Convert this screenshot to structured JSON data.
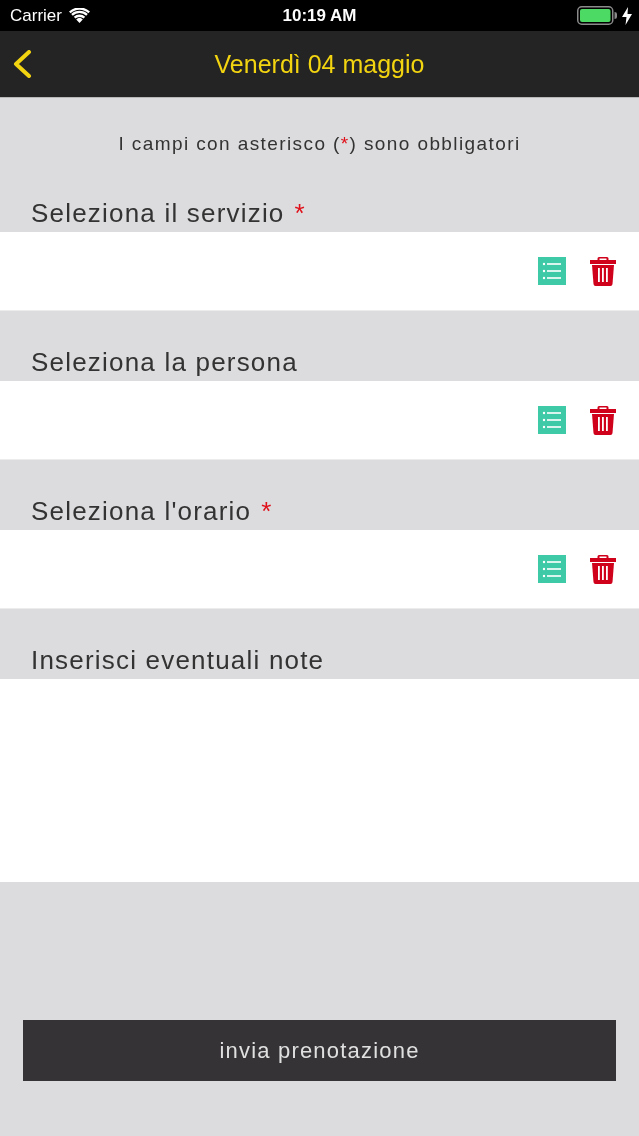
{
  "status_bar": {
    "carrier": "Carrier",
    "time": "10:19 AM"
  },
  "nav_bar": {
    "title": "Venerdì 04 maggio"
  },
  "note": {
    "before": "I campi con asterisco (",
    "mark": "*",
    "after": ") sono obbligatori"
  },
  "fields": [
    {
      "kind": "select",
      "label": "Seleziona il servizio",
      "mark": "*"
    },
    {
      "kind": "select",
      "label": "Seleziona la persona"
    },
    {
      "kind": "select",
      "label": "Seleziona l'orario",
      "mark": "*"
    },
    {
      "kind": "textarea",
      "label": "Inserisci eventuali note"
    }
  ],
  "submit_button": {
    "label": "invia prenotazione"
  }
}
